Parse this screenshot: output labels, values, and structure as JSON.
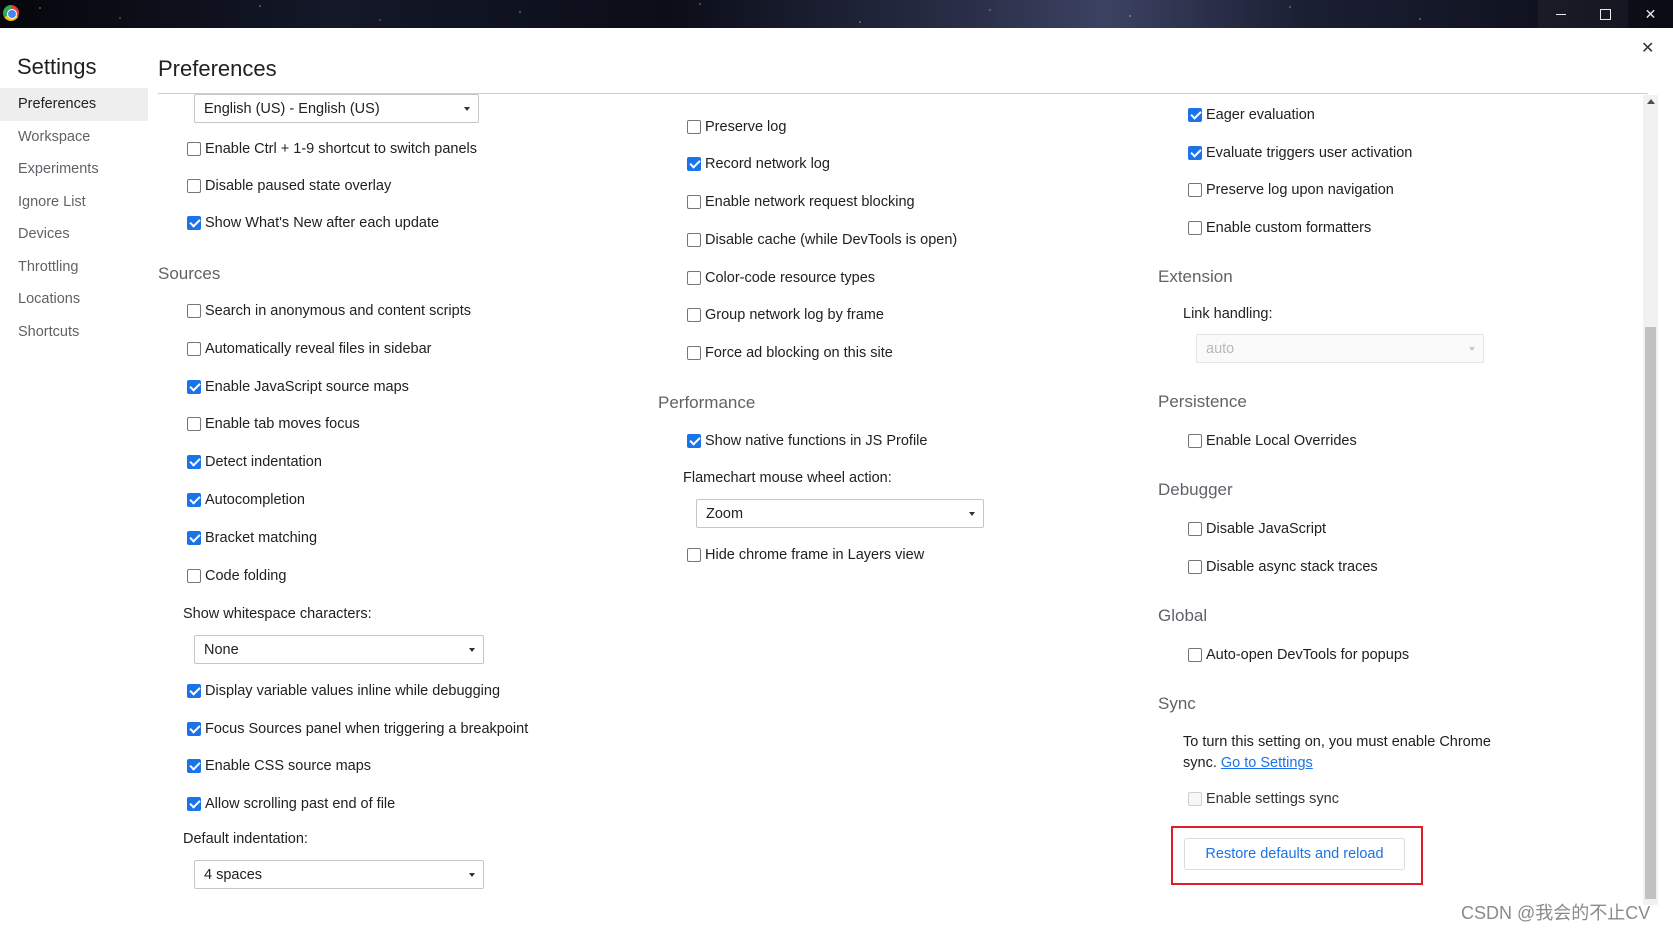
{
  "window": {
    "app_icon": "chrome-icon",
    "controls": [
      "minimize-icon",
      "maximize-icon",
      "close-icon"
    ]
  },
  "sidebar": {
    "title": "Settings",
    "items": [
      {
        "label": "Preferences",
        "active": true
      },
      {
        "label": "Workspace",
        "active": false
      },
      {
        "label": "Experiments",
        "active": false
      },
      {
        "label": "Ignore List",
        "active": false
      },
      {
        "label": "Devices",
        "active": false
      },
      {
        "label": "Throttling",
        "active": false
      },
      {
        "label": "Locations",
        "active": false
      },
      {
        "label": "Shortcuts",
        "active": false
      }
    ]
  },
  "header": {
    "title": "Preferences",
    "close_icon": "close-icon"
  },
  "column1": {
    "language_select": "English (US) - English (US)",
    "checkboxes_top": [
      {
        "label": "Enable Ctrl + 1-9 shortcut to switch panels",
        "checked": false
      },
      {
        "label": "Disable paused state overlay",
        "checked": false
      },
      {
        "label": "Show What's New after each update",
        "checked": true
      }
    ],
    "sources_title": "Sources",
    "sources_checkboxes": [
      {
        "label": "Search in anonymous and content scripts",
        "checked": false
      },
      {
        "label": "Automatically reveal files in sidebar",
        "checked": false
      },
      {
        "label": "Enable JavaScript source maps",
        "checked": true
      },
      {
        "label": "Enable tab moves focus",
        "checked": false
      },
      {
        "label": "Detect indentation",
        "checked": true
      },
      {
        "label": "Autocompletion",
        "checked": true
      },
      {
        "label": "Bracket matching",
        "checked": true
      },
      {
        "label": "Code folding",
        "checked": false
      }
    ],
    "whitespace_label": "Show whitespace characters:",
    "whitespace_value": "None",
    "sources_checkboxes_2": [
      {
        "label": "Display variable values inline while debugging",
        "checked": true
      },
      {
        "label": "Focus Sources panel when triggering a breakpoint",
        "checked": true
      },
      {
        "label": "Enable CSS source maps",
        "checked": true
      },
      {
        "label": "Allow scrolling past end of file",
        "checked": true
      }
    ],
    "indentation_label": "Default indentation:",
    "indentation_value": "4 spaces"
  },
  "column2": {
    "network_checkboxes": [
      {
        "label": "Preserve log",
        "checked": false
      },
      {
        "label": "Record network log",
        "checked": true
      },
      {
        "label": "Enable network request blocking",
        "checked": false
      },
      {
        "label": "Disable cache (while DevTools is open)",
        "checked": false
      },
      {
        "label": "Color-code resource types",
        "checked": false
      },
      {
        "label": "Group network log by frame",
        "checked": false
      },
      {
        "label": "Force ad blocking on this site",
        "checked": false
      }
    ],
    "performance_title": "Performance",
    "performance_checkbox": {
      "label": "Show native functions in JS Profile",
      "checked": true
    },
    "flamechart_label": "Flamechart mouse wheel action:",
    "flamechart_value": "Zoom",
    "layers_checkbox": {
      "label": "Hide chrome frame in Layers view",
      "checked": false
    }
  },
  "column3": {
    "console_checkboxes": [
      {
        "label": "Eager evaluation",
        "checked": true
      },
      {
        "label": "Evaluate triggers user activation",
        "checked": true
      },
      {
        "label": "Preserve log upon navigation",
        "checked": false
      },
      {
        "label": "Enable custom formatters",
        "checked": false
      }
    ],
    "extension_title": "Extension",
    "link_handling_label": "Link handling:",
    "link_handling_value": "auto",
    "persistence_title": "Persistence",
    "persistence_checkbox": {
      "label": "Enable Local Overrides",
      "checked": false
    },
    "debugger_title": "Debugger",
    "debugger_checkboxes": [
      {
        "label": "Disable JavaScript",
        "checked": false
      },
      {
        "label": "Disable async stack traces",
        "checked": false
      }
    ],
    "global_title": "Global",
    "global_checkbox": {
      "label": "Auto-open DevTools for popups",
      "checked": false
    },
    "sync_title": "Sync",
    "sync_text": "To turn this setting on, you must enable Chrome sync.",
    "sync_link": "Go to Settings",
    "sync_checkbox": {
      "label": "Enable settings sync",
      "checked": false,
      "disabled": true
    },
    "restore_button": "Restore defaults and reload"
  },
  "watermark": "CSDN @我会的不止CV",
  "colors": {
    "accent": "#1a73e8",
    "highlight_border": "#e01e2b",
    "section_title": "#5f6368"
  }
}
